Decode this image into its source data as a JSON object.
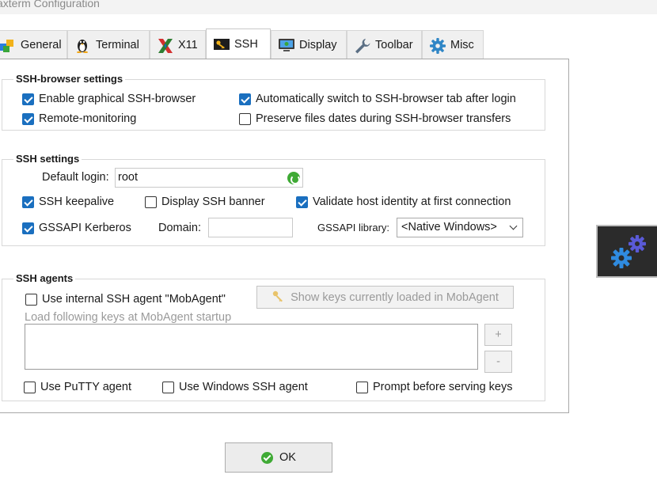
{
  "window": {
    "title": "axterm Configuration"
  },
  "tabs": [
    {
      "label": "General",
      "icon": "general-cubes-icon"
    },
    {
      "label": "Terminal",
      "icon": "terminal-tux-icon"
    },
    {
      "label": "X11",
      "icon": "x11-icon"
    },
    {
      "label": "SSH",
      "icon": "ssh-key-icon",
      "active": true
    },
    {
      "label": "Display",
      "icon": "display-monitor-icon"
    },
    {
      "label": "Toolbar",
      "icon": "toolbar-wrench-icon"
    },
    {
      "label": "Misc",
      "icon": "misc-gear-icon"
    }
  ],
  "ssh_browser": {
    "title": "SSH-browser settings",
    "enable_graphical": {
      "label": "Enable graphical SSH-browser",
      "checked": true
    },
    "auto_switch": {
      "label": "Automatically switch to SSH-browser tab after login",
      "checked": true
    },
    "remote_monitoring": {
      "label": "Remote-monitoring",
      "checked": true
    },
    "preserve_dates": {
      "label": "Preserve files dates during SSH-browser transfers",
      "checked": false
    }
  },
  "ssh_settings": {
    "title": "SSH settings",
    "default_login_label": "Default login:",
    "default_login_value": "root",
    "keepalive": {
      "label": "SSH keepalive",
      "checked": true
    },
    "display_banner": {
      "label": "Display SSH banner",
      "checked": false
    },
    "validate_host": {
      "label": "Validate host identity at first connection",
      "checked": true
    },
    "gssapi_kerberos": {
      "label": "GSSAPI Kerberos",
      "checked": true
    },
    "domain_label": "Domain:",
    "domain_value": "",
    "gssapi_library_label": "GSSAPI library:",
    "gssapi_library_value": "<Native Windows>"
  },
  "ssh_agents": {
    "title": "SSH agents",
    "use_mobagent": {
      "label": "Use internal SSH agent \"MobAgent\"",
      "checked": false
    },
    "show_keys_label": "Show keys currently loaded in MobAgent",
    "load_keys_label": "Load following keys at MobAgent startup",
    "add_label": "+",
    "remove_label": "-",
    "use_putty_agent": {
      "label": "Use PuTTY agent",
      "checked": false
    },
    "use_windows_agent": {
      "label": "Use Windows SSH agent",
      "checked": false
    },
    "prompt_before_serving": {
      "label": "Prompt before serving keys",
      "checked": false
    }
  },
  "footer": {
    "ok_label": "OK"
  },
  "colors": {
    "checkbox_accent": "#1a6fbf",
    "ok_green": "#3faa35"
  }
}
